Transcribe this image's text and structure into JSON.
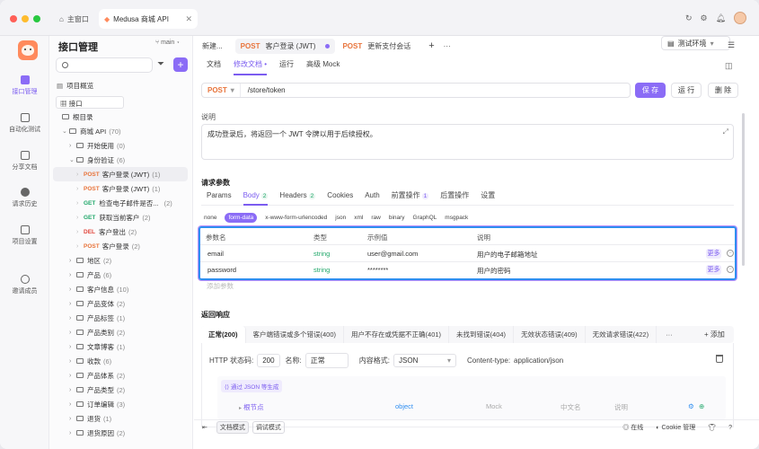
{
  "titlebar": {
    "home_tab": "主窗口",
    "active_tab": "Medusa 商城 API",
    "close_glyph": "✕"
  },
  "rail": {
    "items": [
      {
        "label": "接口管理",
        "icon": "api-icon"
      },
      {
        "label": "自动化测试",
        "icon": "automation-icon"
      },
      {
        "label": "分享文档",
        "icon": "document-icon"
      },
      {
        "label": "请求历史",
        "icon": "history-icon"
      },
      {
        "label": "项目设置",
        "icon": "settings-icon"
      },
      {
        "label": "邀请成员",
        "icon": "invite-icon"
      }
    ]
  },
  "sidebar": {
    "title": "接口管理",
    "branch": "main",
    "project_overview": "项目概览",
    "filter_label": "接口",
    "root": "根目录",
    "tree": [
      {
        "label": "商城 API",
        "count": "(70)",
        "level": 1,
        "kind": "folder",
        "open": true
      },
      {
        "label": "开始使用",
        "count": "(0)",
        "level": 2,
        "kind": "folder"
      },
      {
        "label": "身份验证",
        "count": "(6)",
        "level": 2,
        "kind": "folder",
        "open": true
      },
      {
        "method": "POST",
        "label": "客户登录 (JWT)",
        "count": "(1)",
        "level": 3,
        "kind": "api",
        "selected": true
      },
      {
        "method": "POST",
        "label": "客户登录 (JWT)",
        "count": "(1)",
        "level": 3,
        "kind": "api"
      },
      {
        "method": "GET",
        "label": "检查电子邮件是否...",
        "count": "(2)",
        "level": 3,
        "kind": "api"
      },
      {
        "method": "GET",
        "label": "获取当前客户",
        "count": "(2)",
        "level": 3,
        "kind": "api"
      },
      {
        "method": "DEL",
        "label": "客户登出",
        "count": "(2)",
        "level": 3,
        "kind": "api"
      },
      {
        "method": "POST",
        "label": "客户登录",
        "count": "(2)",
        "level": 3,
        "kind": "api"
      },
      {
        "label": "地区",
        "count": "(2)",
        "level": 2,
        "kind": "folder"
      },
      {
        "label": "产品",
        "count": "(6)",
        "level": 2,
        "kind": "folder"
      },
      {
        "label": "客户信息",
        "count": "(10)",
        "level": 2,
        "kind": "folder"
      },
      {
        "label": "产品变体",
        "count": "(2)",
        "level": 2,
        "kind": "folder"
      },
      {
        "label": "产品标签",
        "count": "(1)",
        "level": 2,
        "kind": "folder"
      },
      {
        "label": "产品类别",
        "count": "(2)",
        "level": 2,
        "kind": "folder"
      },
      {
        "label": "文章博客",
        "count": "(1)",
        "level": 2,
        "kind": "folder"
      },
      {
        "label": "收款",
        "count": "(6)",
        "level": 2,
        "kind": "folder"
      },
      {
        "label": "产品体系",
        "count": "(2)",
        "level": 2,
        "kind": "folder"
      },
      {
        "label": "产品类型",
        "count": "(2)",
        "level": 2,
        "kind": "folder"
      },
      {
        "label": "订单编辑",
        "count": "(3)",
        "level": 2,
        "kind": "folder"
      },
      {
        "label": "退货",
        "count": "(1)",
        "level": 2,
        "kind": "folder"
      },
      {
        "label": "退货原因",
        "count": "(2)",
        "level": 2,
        "kind": "folder"
      }
    ]
  },
  "reqtabs": {
    "new": "新建...",
    "tab1_method": "POST",
    "tab1_label": "客户登录 (JWT)",
    "tab2_method": "POST",
    "tab2_label": "更新支付会话",
    "plus": "+",
    "more": "···",
    "env": "测试环境"
  },
  "subtabs": [
    "文档",
    "修改文档 •",
    "运行",
    "高级 Mock"
  ],
  "request": {
    "method": "POST",
    "path": "/store/token",
    "save": "保 存",
    "run": "运 行",
    "delete": "删 除"
  },
  "description": {
    "label": "说明",
    "text": "成功登录后，将返回一个 JWT 令牌以用于后续授权。"
  },
  "params": {
    "title": "请求参数",
    "tabs": [
      {
        "label": "Params"
      },
      {
        "label": "Body",
        "badge": "2"
      },
      {
        "label": "Headers",
        "badge": "2"
      },
      {
        "label": "Cookies"
      },
      {
        "label": "Auth"
      },
      {
        "label": "前置操作",
        "badge": "1"
      },
      {
        "label": "后置操作"
      },
      {
        "label": "设置"
      }
    ],
    "body_types": [
      "none",
      "form-data",
      "x-www-form-urlencoded",
      "json",
      "xml",
      "raw",
      "binary",
      "GraphQL",
      "msgpack"
    ],
    "columns": [
      "参数名",
      "类型",
      "示例值",
      "说明"
    ],
    "rows": [
      {
        "name": "email",
        "type": "string",
        "example": "user@gmail.com",
        "desc": "用户的电子邮箱地址",
        "more": "更多"
      },
      {
        "name": "password",
        "type": "string",
        "example": "********",
        "desc": "用户的密码",
        "more": "更多"
      }
    ],
    "add_param": "添加参数"
  },
  "response": {
    "title": "返回响应",
    "tabs": [
      "正常(200)",
      "客户端错误或多个错误(400)",
      "用户不存在或凭据不正确(401)",
      "未找到错误(404)",
      "无效状态错误(409)",
      "无效请求错误(422)",
      "···"
    ],
    "add": "+ 添加",
    "status_label": "HTTP 状态码:",
    "status_value": "200",
    "name_label": "名称:",
    "name_value": "正常",
    "format_label": "内容格式:",
    "format_value": "JSON",
    "content_type_label": "Content-type:",
    "content_type_value": "application/json",
    "gen_from_json": "通过 JSON 等生成",
    "schema_root": "根节点",
    "schema_type": "object",
    "schema_mock": "Mock",
    "schema_cn": "中文名",
    "schema_desc": "说明"
  },
  "bottombar": {
    "doc_mode": "文档模式",
    "debug_mode": "调试模式",
    "online": "在线",
    "cookie": "Cookie 管理"
  },
  "colors": {
    "accent": "#8b6cf6",
    "post": "#e8743b",
    "get": "#22a86b",
    "delete": "#e2473d",
    "highlight": "#2f8ef0"
  }
}
